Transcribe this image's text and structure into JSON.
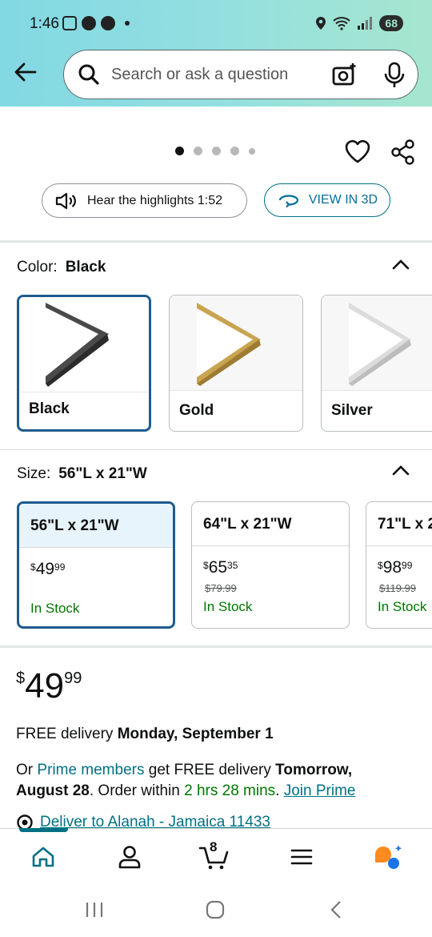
{
  "status_bar": {
    "time": "1:46",
    "battery": "68"
  },
  "search": {
    "placeholder": "Search or ask a question"
  },
  "gallery": {
    "dots": 5,
    "active_index": 0
  },
  "actions": {
    "hear_label": "Hear the highlights 1:52",
    "view3d_label": "VIEW IN 3D"
  },
  "color": {
    "label": "Color:",
    "selected": "Black",
    "options": [
      {
        "name": "Black",
        "frame_color": "#4a4a4a"
      },
      {
        "name": "Gold",
        "frame_color": "#c9a450"
      },
      {
        "name": "Silver",
        "frame_color": "#d6d6d6"
      }
    ]
  },
  "size": {
    "label": "Size:",
    "selected": "56\"L x 21\"W",
    "options": [
      {
        "dims": "56\"L x 21\"W",
        "price_dollars": "49",
        "price_cents": "99",
        "list_price": "",
        "stock": "In Stock"
      },
      {
        "dims": "64\"L x 21\"W",
        "price_dollars": "65",
        "price_cents": "35",
        "list_price": "$79.99",
        "stock": "In Stock"
      },
      {
        "dims": "71\"L x 2",
        "price_dollars": "98",
        "price_cents": "99",
        "list_price": "$119.99",
        "stock": "In Stock"
      }
    ]
  },
  "price": {
    "currency": "$",
    "dollars": "49",
    "cents": "99"
  },
  "delivery": {
    "free_text": "FREE delivery",
    "free_date": "Monday, September 1",
    "or_text": "Or",
    "prime_members": "Prime members",
    "get_text": "get FREE delivery",
    "prime_date": "Tomorrow, August 28",
    "order_within": ". Order within",
    "countdown": "2 hrs 28 mins",
    "period": ".",
    "join_prime": "Join Prime",
    "deliver_to": "Deliver to Alanah - Jamaica 11433"
  },
  "bottom_nav": {
    "cart_count": "8"
  },
  "colors": {
    "accent": "#007185",
    "selected_border": "#1e5b8e",
    "in_stock": "#007600"
  }
}
